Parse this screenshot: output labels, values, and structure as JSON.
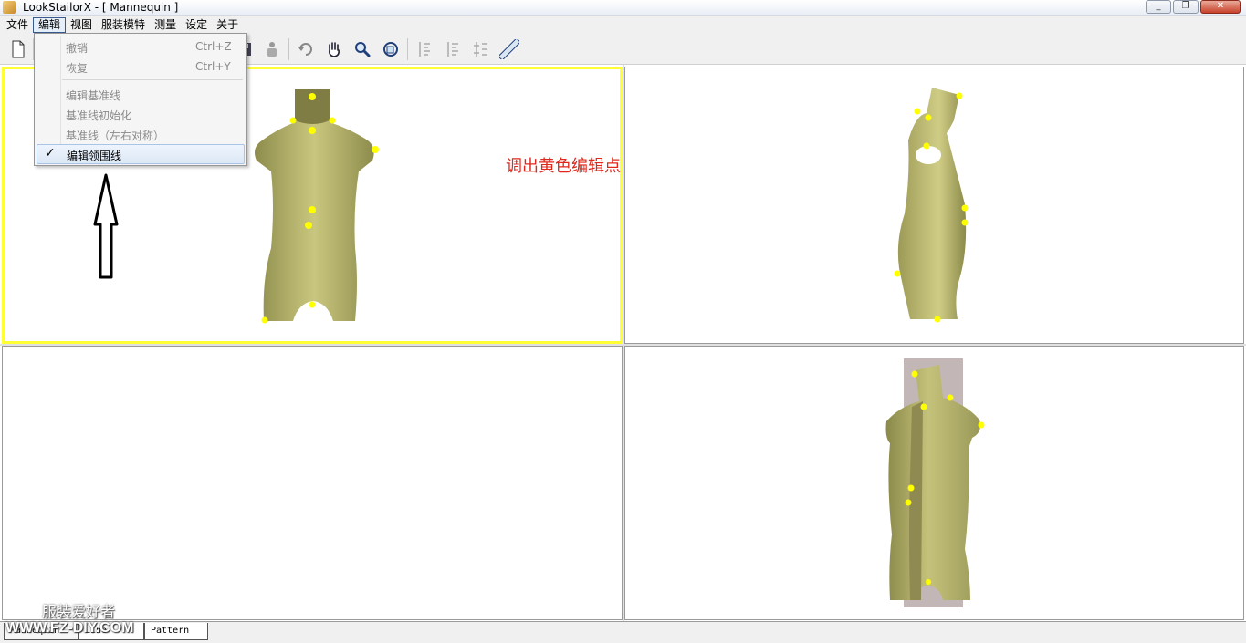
{
  "window": {
    "title": "LookStailorX - [ Mannequin  ]",
    "controls": [
      "_",
      "❐",
      "✕"
    ]
  },
  "menubar": {
    "items": [
      "文件",
      "编辑",
      "视图",
      "服装模特",
      "测量",
      "设定",
      "关于"
    ],
    "open_index": 1
  },
  "toolbar": {
    "icons": [
      "new-file-icon",
      "save-icon",
      "model-icon",
      "rotate-icon",
      "pan-hand-icon",
      "zoom-icon",
      "view-cube-icon",
      "align-left-icon",
      "align-center-icon",
      "align-right-icon",
      "ruler-icon"
    ]
  },
  "edit_menu": {
    "items": [
      {
        "label": "撤销",
        "shortcut": "Ctrl+Z",
        "enabled": false,
        "checked": false
      },
      {
        "label": "恢复",
        "shortcut": "Ctrl+Y",
        "enabled": false,
        "checked": false
      },
      {
        "label": "编辑基准线",
        "shortcut": "",
        "enabled": false,
        "checked": false
      },
      {
        "label": "基准线初始化",
        "shortcut": "",
        "enabled": false,
        "checked": false
      },
      {
        "label": "基准线（左右对称）",
        "shortcut": "",
        "enabled": false,
        "checked": false
      },
      {
        "label": "编辑领围线",
        "shortcut": "",
        "enabled": true,
        "checked": true
      }
    ],
    "check_mark": "✓"
  },
  "annotation": {
    "text": "调出黄色编辑点",
    "color": "#e0281c"
  },
  "colors": {
    "active_viewport_border": "#ffff33",
    "mannequin_skin": "#b8b66a",
    "edit_point": "#ffff00"
  },
  "watermark": {
    "line1": "服装爱好者",
    "line2": "WWW.FZ-DIY.COM"
  },
  "tabs": [
    "Mannequin",
    "Line",
    "Pattern"
  ]
}
